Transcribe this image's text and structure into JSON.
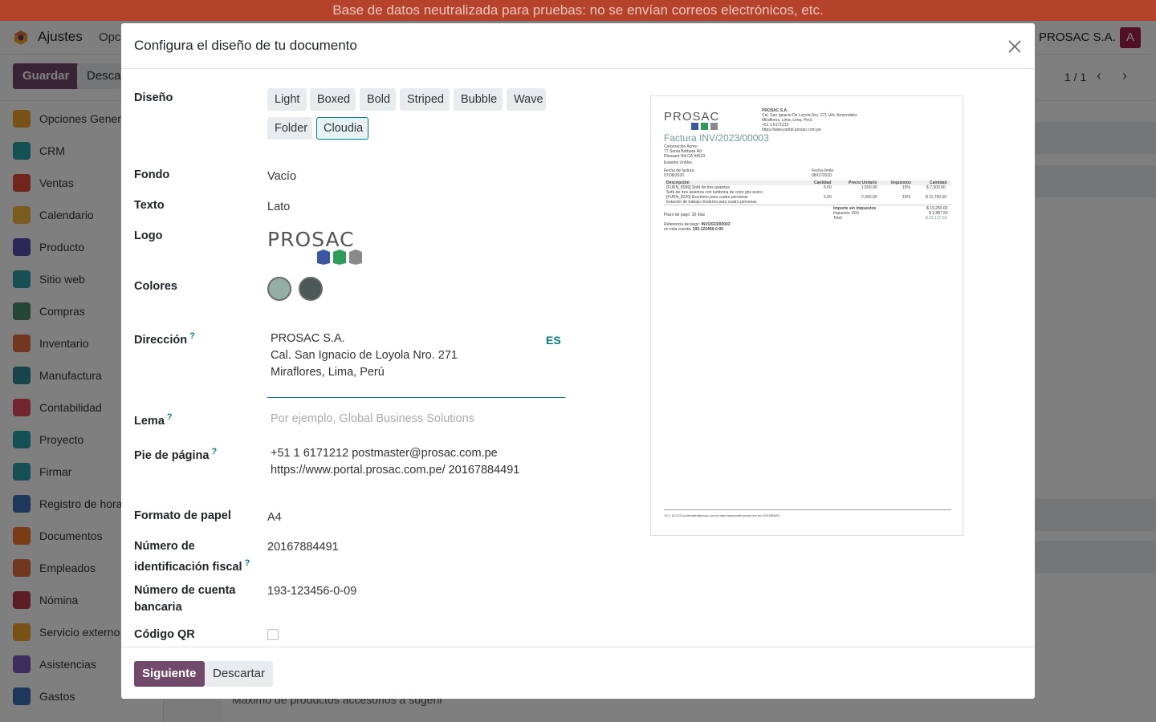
{
  "banner": "Base de datos neutralizada para pruebas: no se envían correos electrónicos, etc.",
  "app": {
    "name": "Ajustes",
    "nav_partial": "Opc",
    "company": "PROSAC S.A.",
    "avatar_letter": "A",
    "save_label": "Guardar",
    "discard_partial": "Descar",
    "pager": "1 / 1"
  },
  "sidebar": {
    "items": [
      {
        "label": "Opciones Genera",
        "color": "#f0a32c"
      },
      {
        "label": "CRM",
        "color": "#27a2a8"
      },
      {
        "label": "Ventas",
        "color": "#e24a3b"
      },
      {
        "label": "Calendario",
        "color": "#f4b93e"
      },
      {
        "label": "Producto",
        "color": "#5b4fb0"
      },
      {
        "label": "Sitio web",
        "color": "#2f9fa8"
      },
      {
        "label": "Compras",
        "color": "#4b8a6f"
      },
      {
        "label": "Inventario",
        "color": "#e56f41"
      },
      {
        "label": "Manufactura",
        "color": "#2f8a93"
      },
      {
        "label": "Contabilidad",
        "color": "#e24a5b"
      },
      {
        "label": "Proyecto",
        "color": "#27a2a8"
      },
      {
        "label": "Firmar",
        "color": "#2f9fa8"
      },
      {
        "label": "Registro de horas",
        "color": "#3d6fb5"
      },
      {
        "label": "Documentos",
        "color": "#f0782c"
      },
      {
        "label": "Empleados",
        "color": "#e56f41"
      },
      {
        "label": "Nómina",
        "color": "#b83a4e"
      },
      {
        "label": "Servicio externo",
        "color": "#f0a32c"
      },
      {
        "label": "Asistencias",
        "color": "#7c5cc0"
      },
      {
        "label": "Gastos",
        "color": "#3d6fb5"
      }
    ]
  },
  "background": {
    "bottom_text": "Máximo de productos accesorios a sugerir"
  },
  "modal": {
    "title": "Configura el diseño de tu documento",
    "labels": {
      "diseno": "Diseño",
      "fondo": "Fondo",
      "texto": "Texto",
      "logo": "Logo",
      "colores": "Colores",
      "direccion": "Dirección",
      "lema": "Lema",
      "pie": "Pie de página",
      "formato": "Formato de papel",
      "nif_1": "Número de",
      "nif_2": "identificación fiscal",
      "cuenta_1": "Número de cuenta",
      "cuenta_2": "bancaria",
      "qr": "Código QR",
      "help": "?"
    },
    "layouts": [
      "Light",
      "Boxed",
      "Bold",
      "Striped",
      "Bubble",
      "Wave",
      "Folder",
      "Cloudia"
    ],
    "active_layout": "Cloudia",
    "fondo_value": "Vacío",
    "texto_value": "Lato",
    "logo_text": "PROSAC",
    "colors": {
      "primary": "#93aea4",
      "secondary": "#4b5a57"
    },
    "address": {
      "line1": "PROSAC S.A.",
      "line2": "Cal. San Ignacio de Loyola Nro. 271",
      "line3": "Miraflores, Lima, Perú",
      "lang": "ES"
    },
    "lema_placeholder": "Por ejemplo, Global Business Solutions",
    "footer": {
      "line1": "+51 1 6171212 postmaster@prosac.com.pe",
      "line2": "https://www.portal.prosac.com.pe/ 20167884491"
    },
    "paper_format": "A4",
    "tax_id": "20167884491",
    "bank_account": "193-123456-0-09",
    "buttons": {
      "next": "Siguiente",
      "discard": "Descartar"
    }
  },
  "preview": {
    "logo": "PROSAC",
    "company_block": [
      "PROSAC S.A.",
      "Cal. San Ignacio De Loyola Nro. 271 Urb. Armendáriz",
      "Miraflores, Lima, Lima, Perú",
      "+51 1 6171212",
      "https://www.portal.prosac.com.pe"
    ],
    "title": "Factura INV/2023/00003",
    "customer": [
      "Corporación Acme",
      "77 Santa Bárbara Rd",
      "Pleasant Hill CA 94523",
      "Estados Unidos"
    ],
    "invoice_date_label": "Fecha de factura",
    "invoice_date": "07/08/2020",
    "due_date_label": "Fecha límite",
    "due_date": "08/07/2020",
    "columns": [
      "Descripción",
      "Cantidad",
      "Precio Unitario",
      "Impuestos",
      "Cantidad"
    ],
    "rows": [
      {
        "desc": "[FURN_8999] Sofá de tres asientos",
        "sub": "Sofá de tres asientos con tumbona de color gris acero",
        "qty": "5.00",
        "price": "1,500.00",
        "tax": "15%",
        "amount": "$ 7,500.00"
      },
      {
        "desc": "[FURN_8220] Escritorio para cuatro personas",
        "sub": "Estación de trabajo moderna para cuatro personas",
        "qty": "5.00",
        "price": "2,350.00",
        "tax": "15%",
        "amount": "$ 11,750.00"
      }
    ],
    "terms": "Plazo de pago: 30 días",
    "untaxed_label": "Importe sin impuestos",
    "untaxed": "$ 19,250.00",
    "tax_label": "Impuesto 15%",
    "tax": "$ 2,887.50",
    "total_label": "Total",
    "total": "$ 22,137.50",
    "payment_ref_label": "Referencia de pago:",
    "payment_ref": "INV/2023/00003",
    "account_label": "en esta cuenta:",
    "account": "193-123456-0-09",
    "footer": "+51 1 6171212 postmaster@prosac.com.pe https://www.portal.prosac.com.pe/ 20167884491"
  }
}
